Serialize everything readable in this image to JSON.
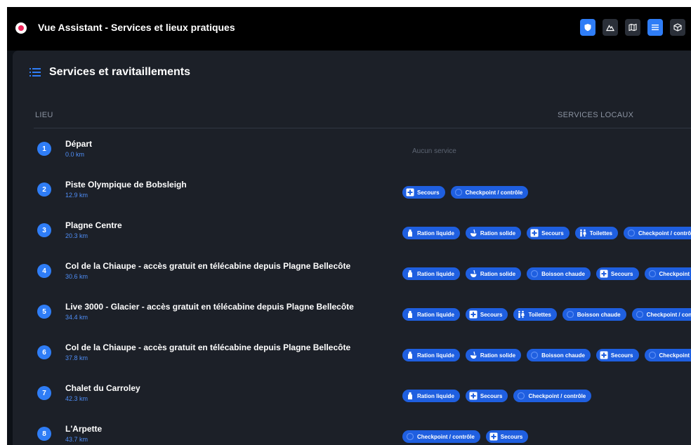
{
  "window": {
    "title": "Vue Assistant - Services et lieux pratiques",
    "toolbar": [
      {
        "icon": "shield-icon",
        "active": true
      },
      {
        "icon": "mountain-icon",
        "active": false
      },
      {
        "icon": "map-icon",
        "active": false
      },
      {
        "icon": "list-icon",
        "active": true
      },
      {
        "icon": "box-icon",
        "active": false
      }
    ]
  },
  "panel": {
    "title": "Services et ravitaillements",
    "columns": {
      "place": "LIEU",
      "services": "SERVICES LOCAUX"
    },
    "no_service": "Aucun service"
  },
  "labels": {
    "ration_liquide": "Ration liquide",
    "ration_solide": "Ration solide",
    "secours": "Secours",
    "toilettes": "Toilettes",
    "checkpoint": "Checkpoint / contrôle",
    "boisson_chaude": "Boisson chaude"
  },
  "colors": {
    "accent": "#2f7df6",
    "pill": "#1f5fe0",
    "background": "#1c2028"
  },
  "rows": [
    {
      "num": "1",
      "name": "Départ",
      "dist": "0.0 km",
      "services": []
    },
    {
      "num": "2",
      "name": "Piste Olympique de Bobsleigh",
      "dist": "12.9 km",
      "services": [
        "secours",
        "checkpoint"
      ]
    },
    {
      "num": "3",
      "name": "Plagne Centre",
      "dist": "20.3 km",
      "services": [
        "ration_liquide",
        "ration_solide",
        "secours",
        "toilettes",
        "checkpoint"
      ]
    },
    {
      "num": "4",
      "name": "Col de la Chiaupe - accès gratuit en télécabine depuis Plagne Bellecôte",
      "dist": "30.6 km",
      "services": [
        "ration_liquide",
        "ration_solide",
        "boisson_chaude",
        "secours",
        "checkpoint"
      ]
    },
    {
      "num": "5",
      "name": "Live 3000 - Glacier - accès gratuit en télécabine depuis Plagne Bellecôte",
      "dist": "34.4 km",
      "services": [
        "ration_liquide",
        "secours",
        "toilettes",
        "boisson_chaude",
        "checkpoint"
      ]
    },
    {
      "num": "6",
      "name": "Col de la Chiaupe - accès gratuit en télécabine depuis Plagne Bellecôte",
      "dist": "37.8 km",
      "services": [
        "ration_liquide",
        "ration_solide",
        "boisson_chaude",
        "secours",
        "checkpoint"
      ]
    },
    {
      "num": "7",
      "name": "Chalet du Carroley",
      "dist": "42.3 km",
      "services": [
        "ration_liquide",
        "secours",
        "checkpoint"
      ]
    },
    {
      "num": "8",
      "name": "L'Arpette",
      "dist": "43.7 km",
      "services": [
        "checkpoint",
        "secours"
      ]
    }
  ]
}
